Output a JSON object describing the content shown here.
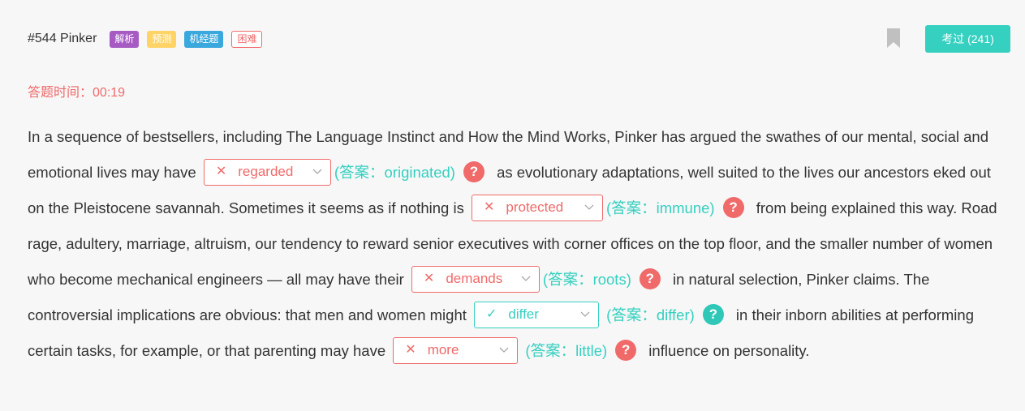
{
  "header": {
    "title": "#544 Pinker",
    "tags": [
      "解析",
      "预测",
      "机经题",
      "困难"
    ],
    "exam_button": "考过 (241)"
  },
  "timer": {
    "label": "答题时间：",
    "value": "00:19"
  },
  "colors": {
    "wrong": "#f06a6a",
    "correct": "#35d0c0",
    "bookmark": "#c0c0c0"
  },
  "passage": {
    "seg0": "In a sequence of bestsellers, including The Language Instinct and How the Mind Works, Pinker has argued the swathes of our mental, social and emotional lives may have",
    "seg1": "as evolutionary adaptations, well suited to the lives our ancestors eked out on the Pleistocene savannah. Sometimes it seems as if nothing is",
    "seg2": "from being explained this way. Road rage, adultery, marriage, altruism, our tendency to reward senior executives with corner offices on the top floor, and the smaller number of women who become mechanical engineers — all may have their",
    "seg3": "in natural selection, Pinker claims. The controversial implications are obvious: that men and women might",
    "seg4": "in their inborn abilities at performing certain tasks, for example, or that parenting may have",
    "seg5": "influence on personality."
  },
  "blanks": [
    {
      "selected": "regarded",
      "status_icon": "x-icon",
      "status_glyph": "✕",
      "answer": "(答案：originated)",
      "help": "?"
    },
    {
      "selected": "protected",
      "status_icon": "x-icon",
      "status_glyph": "✕",
      "answer": "(答案：immune)",
      "help": "?"
    },
    {
      "selected": "demands",
      "status_icon": "x-icon",
      "status_glyph": "✕",
      "answer": "(答案：roots)",
      "help": "?"
    },
    {
      "selected": "differ",
      "status_icon": "check-icon",
      "status_glyph": "✓",
      "answer": "(答案：differ)",
      "help": "?"
    },
    {
      "selected": "more",
      "status_icon": "x-icon",
      "status_glyph": "✕",
      "answer": "(答案：little)",
      "help": "?"
    }
  ]
}
